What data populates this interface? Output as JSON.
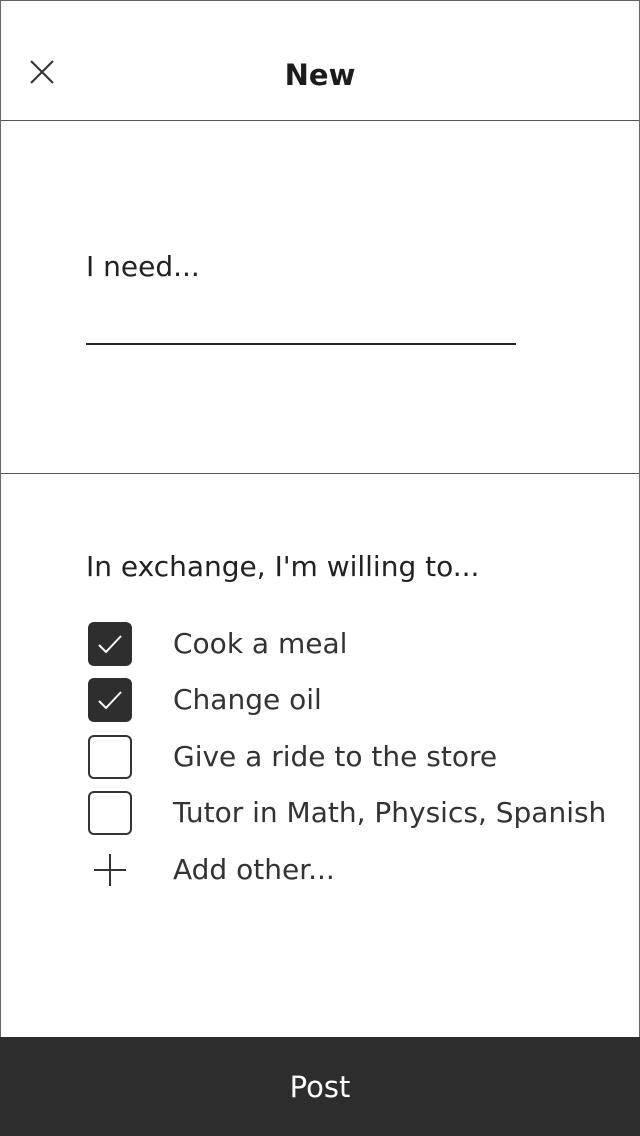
{
  "header": {
    "title": "New",
    "close_icon": "close-icon"
  },
  "need": {
    "label": "I need...",
    "value": ""
  },
  "exchange": {
    "label": "In exchange, I'm willing to...",
    "options": [
      {
        "label": "Cook a meal",
        "checked": true
      },
      {
        "label": "Change oil",
        "checked": true
      },
      {
        "label": "Give a ride to the store",
        "checked": false
      },
      {
        "label": "Tutor in Math, Physics, Spanish",
        "checked": false
      }
    ],
    "add_other": {
      "label": "Add other...",
      "icon": "plus-icon"
    }
  },
  "footer": {
    "post_label": "Post"
  },
  "colors": {
    "post_bar": "#2d2d2d",
    "checked_fill": "#2e2e2e",
    "text": "#222222"
  }
}
